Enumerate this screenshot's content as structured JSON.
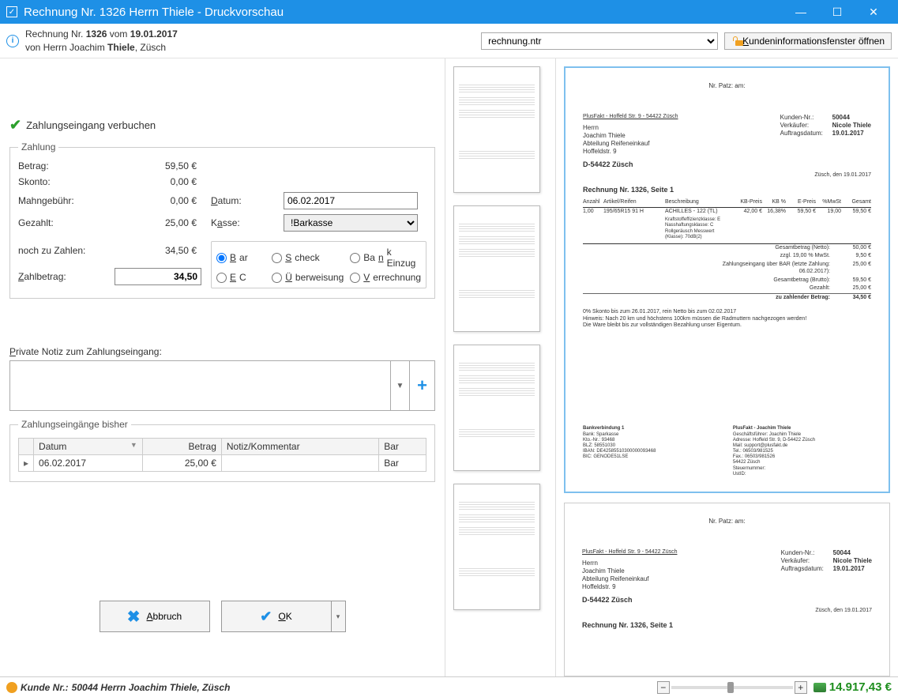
{
  "window": {
    "title": "Rechnung Nr. 1326 Herrn Thiele - Druckvorschau"
  },
  "header": {
    "line1_pre": "Rechnung Nr. ",
    "invoice_no": "1326",
    "line1_mid": " vom ",
    "invoice_date": "19.01.2017",
    "line2_pre": "von Herrn Joachim ",
    "cust_surname": "Thiele",
    "line2_post": ", Züsch"
  },
  "toolbar": {
    "template": "rechnung.ntr",
    "kundeninfo": "Kundeninformationsfenster öffnen"
  },
  "payment": {
    "title": "Zahlungseingang verbuchen",
    "legend": "Zahlung",
    "labels": {
      "betrag": "Betrag:",
      "skonto": "Skonto:",
      "mahngeb": "Mahngebühr:",
      "gezahlt": "Gezahlt:",
      "noch": "noch zu Zahlen:",
      "zahlbetrag": "Zahlbetrag:",
      "datum": "Datum:",
      "kasse": "Kasse:"
    },
    "values": {
      "betrag": "59,50 €",
      "skonto": "0,00 €",
      "mahngeb": "0,00 €",
      "gezahlt": "25,00 €",
      "noch": "34,50 €",
      "zahlbetrag": "34,50",
      "datum": "06.02.2017",
      "kasse": "!Barkasse"
    },
    "methods": {
      "bar": "Bar",
      "scheck": "Scheck",
      "bank": "Bank Einzug",
      "ec": "EC",
      "ueberweisung": "Überweisung",
      "verrechnung": "Verrechnung"
    },
    "selected_method": "bar"
  },
  "private_note": {
    "label": "Private Notiz zum Zahlungseingang:",
    "value": ""
  },
  "history": {
    "legend": "Zahlungseingänge bisher",
    "cols": {
      "datum": "Datum",
      "betrag": "Betrag",
      "notiz": "Notiz/Kommentar",
      "bar": "Bar"
    },
    "rows": [
      {
        "datum": "06.02.2017",
        "betrag": "25,00 €",
        "notiz": "",
        "bar": "Bar"
      }
    ]
  },
  "buttons": {
    "abbruch": "Abbruch",
    "ok": "OK"
  },
  "preview": {
    "nrpatz": "Nr. Patz: am:",
    "sender": "PlusFakt - Hoffeld Str. 9 - 54422 Züsch",
    "addr": {
      "anrede": "Herrn",
      "name": "Joachim Thiele",
      "abt": "Abteilung Reifeneinkauf",
      "str": "Hoffeldstr. 9",
      "plz": "D-54422 Züsch"
    },
    "meta": {
      "kundennr_l": "Kunden-Nr.:",
      "kundennr": "50044",
      "verk_l": "Verkäufer:",
      "verk": "Nicole Thiele",
      "auftrag_l": "Auftragsdatum:",
      "auftrag": "19.01.2017"
    },
    "docline": "Züsch, den 19.01.2017",
    "rechtitle": "Rechnung Nr. 1326, Seite 1",
    "cols": {
      "anzahl": "Anzahl",
      "artikel": "Artikel/Reifen",
      "beschr": "Beschreibung",
      "kbpreis": "KB-Preis",
      "kb": "KB %",
      "epreis": "E-Preis",
      "mwst": "%MwSt",
      "gesamt": "Gesamt"
    },
    "items": [
      {
        "anzahl": "1,00",
        "art": "195/65R15 91 H",
        "beschr": "ACHILLES - 122 (TL)",
        "kbp": "42,00 €",
        "kb": "16,38%",
        "ep": "59,50 €",
        "mwst": "19,00",
        "ges": "59,50 €"
      },
      {
        "anzahl": "",
        "art": "",
        "beschr": "Kraftstoffeffizienzklasse: E   Nasshaftungsklasse: C   Rollgeräusch Messwert (Klasse): 70dB(2)",
        "kbp": "",
        "kb": "",
        "ep": "",
        "mwst": "",
        "ges": ""
      }
    ],
    "sums": [
      {
        "l": "zzgl. 19,00 % MwSt.",
        "v": "9,50 €"
      },
      {
        "l": "Gesamtbetrag (Netto):",
        "v": "50,00 €"
      },
      {
        "l": "Zahlungseingang über BAR  (letzte Zahlung: 06.02.2017):",
        "v": "25,00 €"
      },
      {
        "l": "Gesamtbetrag (Brutto):",
        "v": "59,50 €"
      },
      {
        "l": "Gezahlt:",
        "v": "25,00 €"
      }
    ],
    "finalsum": {
      "l": "zu zahlender Betrag:",
      "v": "34,50 €"
    },
    "notes": [
      "0% Skonto bis zum 26.01.2017, rein Netto bis zum 02.02.2017",
      "Hinweis: Nach 20 km und höchstens 100km müssen die Radmuttern nachgezogen werden!",
      "Die Ware bleibt bis zur vollständigen Bezahlung unser Eigentum."
    ],
    "footL": {
      "t": "Bankverbindung 1",
      "lines": [
        "Bank: Sparkasse",
        "Kto.-Nr.: 93468",
        "BLZ: 58551030",
        "IBAN: DE42585510300000093468",
        "BIC: GENODE51LSE"
      ]
    },
    "footR": {
      "t": "PlusFakt - Joachim Thiele",
      "lines": [
        "Geschäftsführer: Joachim Thiele",
        "Adresse: Hoffeld Str. 9, D-54422 Züsch",
        "Mail: support@plusfakt.de",
        "Tel.: 06503/981525",
        "Fax.: 06503/981526",
        "54422 Züsch",
        "Steuernummer:",
        "UstID:"
      ]
    }
  },
  "statusbar": {
    "kunde_pre": "Kunde  Nr.: ",
    "kunde": "50044 Herrn Joachim Thiele, Züsch",
    "balance": "14.917,43 €"
  }
}
